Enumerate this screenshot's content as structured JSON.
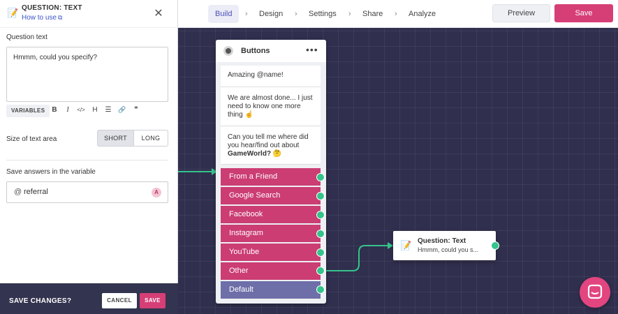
{
  "nav": {
    "steps": [
      "Build",
      "Design",
      "Settings",
      "Share",
      "Analyze"
    ],
    "separator": "›",
    "preview_label": "Preview",
    "save_label": "Save"
  },
  "panel": {
    "title": "QUESTION: TEXT",
    "how_to_link": "How to use",
    "question_text_label": "Question text",
    "question_text_value": "Hmmm, could you specify?",
    "variables_label": "VARIABLES",
    "toolbar_icons": {
      "bold": "B",
      "italic": "I",
      "code": "</>",
      "heading": "H",
      "list": "☰",
      "link": "🔗",
      "quote": "❞"
    },
    "size_label": "Size of text area",
    "size_short": "SHORT",
    "size_long": "LONG",
    "size_selected": "SHORT",
    "save_var_label": "Save answers in the variable",
    "variable_prefix": "@",
    "variable_value": "referral",
    "variable_badge": "A",
    "save_changes_label": "SAVE CHANGES?",
    "cancel_label": "CANCEL",
    "save_label": "SAVE"
  },
  "buttons_node": {
    "title": "Buttons",
    "menu": "•••",
    "messages": [
      "Amazing @name!",
      "We are almost done... I just need to know one more thing ☝",
      "Can you tell me where did you hear/find out about"
    ],
    "message_bold": "GameWorld?",
    "message_emoji": "🤔",
    "options": [
      "From a Friend",
      "Google Search",
      "Facebook",
      "Instagram",
      "YouTube",
      "Other",
      "Default"
    ]
  },
  "question_node": {
    "title": "Question: Text",
    "preview": "Hmmm, could you s..."
  },
  "colors": {
    "accent": "#d63e76",
    "option": "#cb3d73",
    "default_option": "#6e6fa8",
    "port": "#35c48b",
    "canvas": "#302f4e"
  },
  "icons": {
    "panel": "memo-icon",
    "close": "close-icon",
    "external": "external-link-icon",
    "chat": "chat-icon"
  }
}
